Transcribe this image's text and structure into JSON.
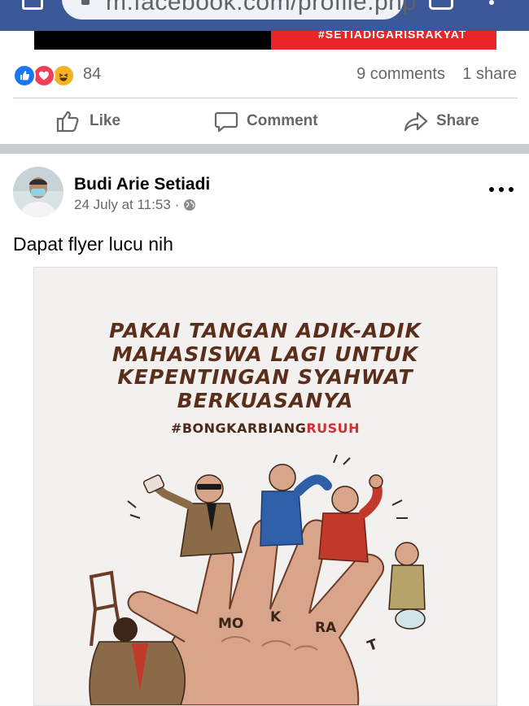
{
  "browser": {
    "url": "m.facebook.com/profile.php"
  },
  "previous_post": {
    "image_banner_text": "#SETIADIGARISRAKYAT"
  },
  "reactions": {
    "icons": [
      "like-reaction",
      "love-reaction",
      "haha-reaction"
    ],
    "count": "84",
    "comments": "9 comments",
    "shares": "1 share"
  },
  "actions": {
    "like_label": "Like",
    "comment_label": "Comment",
    "share_label": "Share"
  },
  "post": {
    "author": "Budi Arie Setiadi",
    "timestamp": "24 July at 11:53",
    "separator": "·",
    "privacy_icon": "globe-icon",
    "text": "Dapat flyer lucu nih"
  },
  "flyer": {
    "headline": [
      "PAKAI TANGAN ADIK-ADIK",
      "MAHASISWA LAGI UNTUK",
      "KEPENTINGAN SYAHWAT",
      "BERKUASANYA"
    ],
    "hashtag_prefix": "#BONGKARBIANG",
    "hashtag_suffix": "RUSUH",
    "finger_labels": [
      "MO",
      "K",
      "RA",
      "T"
    ]
  },
  "colors": {
    "browser_bar": "#3b5998",
    "like_blue": "#1877f2",
    "love_red": "#f33e58",
    "haha_yellow": "#f7b125",
    "secondary_text": "#65676b",
    "hashtag_red": "#d32f2f"
  }
}
